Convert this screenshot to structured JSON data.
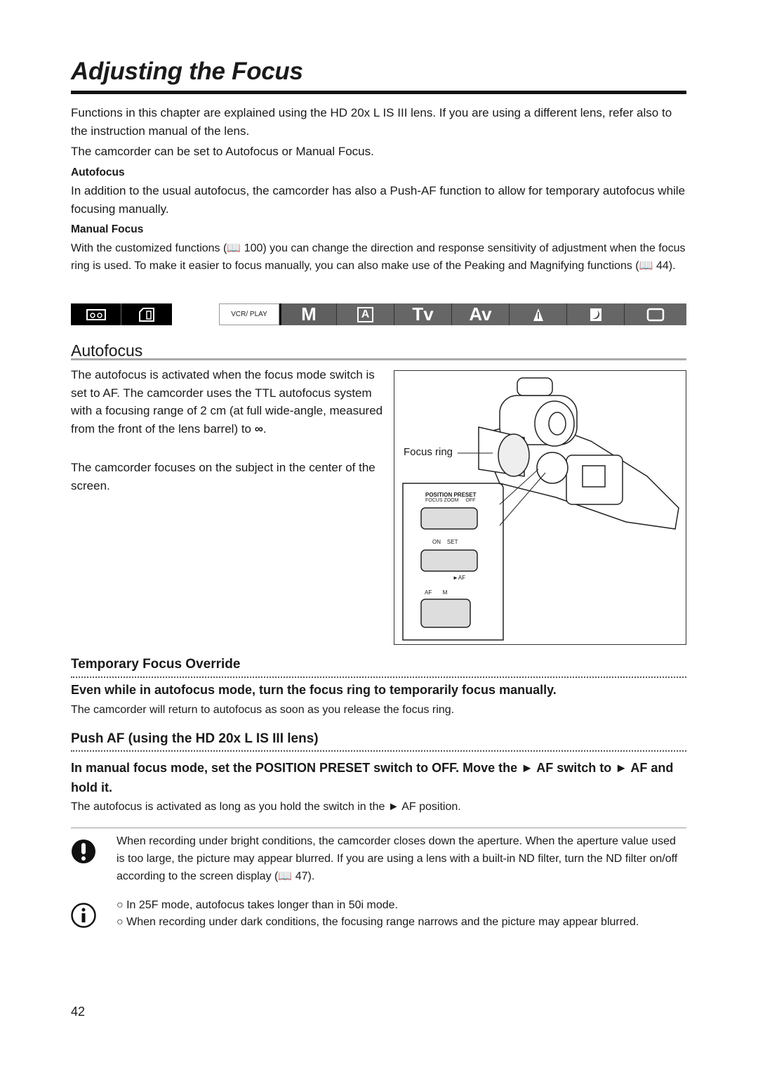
{
  "title": "Adjusting the Focus",
  "intro": [
    "Functions in this chapter are explained using the HD 20x L IS III lens. If you are using a different lens, refer also to the instruction manual of the lens.",
    "The camcorder can be set to Autofocus or Manual Focus."
  ],
  "autofocus_sub": {
    "heading": "Autofocus",
    "text": "In addition to the usual autofocus, the camcorder has also a Push-AF function to allow for temporary autofocus while focusing manually."
  },
  "manual_sub": {
    "heading": "Manual Focus",
    "text_a": "With the customized functions (",
    "ref1": "100",
    "text_b": ") you can change the direction and response sensitivity of adjustment when the focus ring is used. To make it easier to focus manually, you can also make use of the Peaking and Magnifying functions (",
    "ref2": "44",
    "text_c": ")."
  },
  "mode_bar": {
    "media": [
      "tape-icon",
      "card-icon"
    ],
    "modes": [
      "VCR/ PLAY",
      "M",
      "A",
      "Tv",
      "Av",
      "spotlight-icon",
      "night-icon",
      "full-auto-icon"
    ],
    "active": "VCR/ PLAY"
  },
  "section": {
    "heading": "Autofocus",
    "para1_a": "The autofocus is activated when the focus mode switch is set to AF. The camcorder uses the TTL autofocus system with a focusing range of 2 cm (at full wide-angle, measured from the front of the lens barrel) to ",
    "para1_b": ".",
    "infinity": "∞",
    "para2": "The camcorder focuses on the subject in the center of the screen."
  },
  "figure": {
    "focus_ring": "Focus ring",
    "position_preset": "POSITION PRESET",
    "focus": "FOCUS",
    "zoom": "ZOOM",
    "off": "OFF",
    "on": "ON",
    "set": "SET",
    "push_af": "►AF",
    "af": "AF",
    "m": "M"
  },
  "override": {
    "heading": "Temporary Focus Override",
    "instruction": "Even while in autofocus mode, turn the focus ring to temporarily focus manually.",
    "note": "The camcorder will return to autofocus as soon as you release the focus ring."
  },
  "push_af": {
    "heading": "Push AF (using the HD 20x L IS III lens)",
    "instruction": "In manual focus mode, set the POSITION PRESET switch to OFF. Move the ► AF switch to ► AF and hold it.",
    "note": "The autofocus is activated as long as you hold the switch in the ► AF position."
  },
  "caution": {
    "text_a": "When recording under bright conditions, the camcorder closes down the aperture. When the aperture value used is too large, the picture may appear blurred. If you are using a lens with a built-in ND filter, turn the ND filter on/off according to the screen display (",
    "ref": "47",
    "text_b": ")."
  },
  "info": {
    "items": [
      "In 25F mode, autofocus takes longer than in 50i mode.",
      "When recording under dark conditions, the focusing range narrows and the picture may appear blurred."
    ]
  },
  "page_number": "42"
}
